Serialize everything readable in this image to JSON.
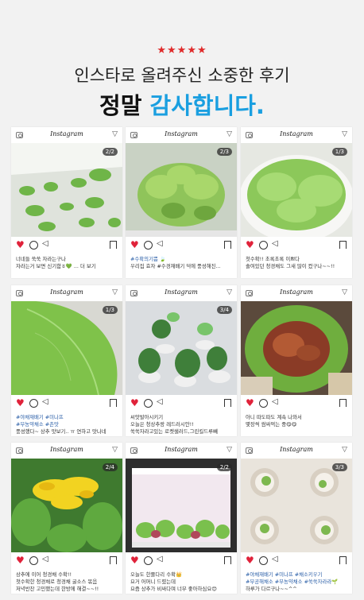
{
  "header": {
    "stars": "★★★★★",
    "subtitle": "인스타로 올려주신 소중한 후기",
    "title_part1": "정말",
    "title_part2": "감사합니다."
  },
  "brand": "Instagram",
  "colors": {
    "accent_blue": "#1a9fe0",
    "heart_red": "#e0223a",
    "hashtag_blue": "#2b5fa8"
  },
  "posts": [
    {
      "badge": "2/2",
      "lines": [
        "너네들 쑥쑥 자라는구나",
        "자라는거 보면 신기함ㅎ💚 ... 더 보기"
      ]
    },
    {
      "badge": "2/3",
      "lines": [
        "#수확의기쁨 🍃",
        "우리집 효자 #수경재배기 덕에 풍성해진..."
      ]
    },
    {
      "badge": "1/3",
      "lines": [
        "첫수확!! 초록초록 이쁘다",
        "솔여있던 청경채도 그새 많이 컸구나~~!!"
      ]
    },
    {
      "badge": "1/3",
      "lines": [
        "#야채재배기 #미나프",
        "#무농약채소 #촌맛",
        "풍성했다~ 상추 맛보기.. ㅠ 연하고 맛나네"
      ]
    },
    {
      "badge": "3/4",
      "lines": [
        "씨앗발아시키기",
        "오늘은 청상추랑 레드러시안!!",
        "쑥쑥자라고있는 로켓샐러드,그린킬드루빼"
      ]
    },
    {
      "badge": "",
      "lines": [
        "아니 따도따도 계속 나와서",
        "몇장씩 쌈싸먹는 중😋😋"
      ]
    },
    {
      "badge": "2/4",
      "lines": [
        "상추에 이어 청경채 수확!!",
        "첫수확한 청경채로 청경채 굴소스 볶음",
        "저녁반찬 고민했는데 한방에 해결~~!!"
      ]
    },
    {
      "badge": "2/2",
      "lines": [
        "오늘도 한쫄다리 수확👑",
        "요거 어머니 드렸는데",
        "요즘 상추가 비싸다며 너무 좋아하심요😊"
      ]
    },
    {
      "badge": "3/3",
      "lines": [
        "#야채재배기 #미나프 #채소키우기",
        "#무공해채소 #무농약채소 #쑥쑥자라라🌱",
        "하루가 다르구나~~^^"
      ]
    }
  ]
}
